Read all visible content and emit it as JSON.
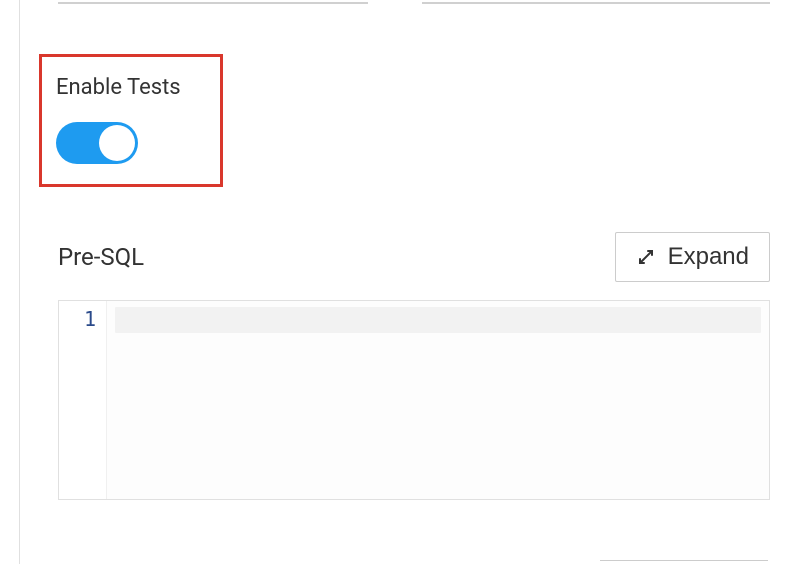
{
  "enable_tests": {
    "label": "Enable Tests",
    "state": "on"
  },
  "pre_sql": {
    "label": "Pre-SQL",
    "expand_label": "Expand",
    "line_number": "1",
    "content": ""
  },
  "colors": {
    "highlight_border": "#d9372c",
    "toggle_on": "#1e9bf0"
  }
}
